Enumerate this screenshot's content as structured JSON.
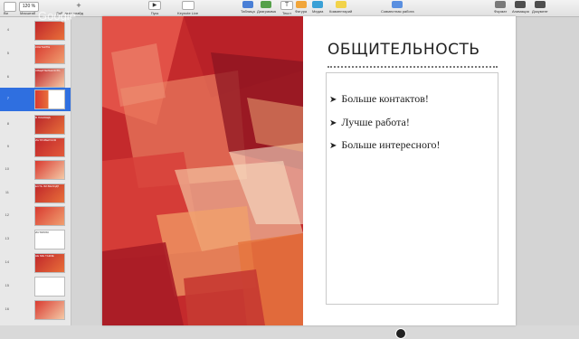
{
  "toolbar": {
    "zoom": "120 %",
    "view_label": "Ви",
    "left_labels": [
      "Масштаб",
      "Доб. авто.слайд"
    ],
    "buttons": [
      {
        "label": "Пуск",
        "icon": "play-icon"
      },
      {
        "label": "Keynote Live",
        "icon": "broadcast-icon"
      },
      {
        "label": "Таблица",
        "icon": "table-icon",
        "color": "#4a7fd6"
      },
      {
        "label": "Диаграмма",
        "icon": "chart-icon",
        "color": "#55a04a"
      },
      {
        "label": "Текст",
        "icon": "text-icon",
        "color": "#888888"
      },
      {
        "label": "Фигура",
        "icon": "shape-icon",
        "color": "#f1a53a"
      },
      {
        "label": "Медиа",
        "icon": "media-icon",
        "color": "#3aa0d6"
      },
      {
        "label": "Комментарий",
        "icon": "comment-icon",
        "color": "#f2d34a"
      },
      {
        "label": "Совместная работа",
        "icon": "collaborate-icon",
        "color": "#5a8fe0"
      },
      {
        "label": "Формат",
        "icon": "format-icon",
        "color": "#7a7a7a"
      },
      {
        "label": "Анимация",
        "icon": "animate-icon",
        "color": "#4e4e4e"
      },
      {
        "label": "Документ",
        "icon": "document-icon",
        "color": "#4e4e4e"
      }
    ]
  },
  "watermark": "Google",
  "sidebar": {
    "thumbnails": [
      {
        "num": "4",
        "caption": ""
      },
      {
        "num": "5",
        "caption": "КОНТАКТЫ"
      },
      {
        "num": "6",
        "caption": "ОБЩИТЕЛЬНОСТЬ"
      },
      {
        "num": "7",
        "caption": "",
        "selected": true
      },
      {
        "num": "8",
        "caption": "В ПОМОЩЬ"
      },
      {
        "num": "9",
        "caption": "ИНТРОВЕРСИЯ"
      },
      {
        "num": "10",
        "caption": ""
      },
      {
        "num": "11",
        "caption": "ЕСТЬ ЛИ ВЫХОД?"
      },
      {
        "num": "12",
        "caption": ""
      },
      {
        "num": "13",
        "caption": "ИСТОРИЯ"
      },
      {
        "num": "14",
        "caption": "НЕ МЫ ТАКИЕ"
      },
      {
        "num": "15",
        "caption": ""
      },
      {
        "num": "16",
        "caption": ""
      }
    ]
  },
  "slide": {
    "title": "ОБЩИТЕЛЬНОСТЬ",
    "bullets": [
      "Больше контактов!",
      "Лучше работа!",
      "Больше интересного!"
    ],
    "bullet_marker": "➤"
  },
  "colors": {
    "selection": "#2f6fe0",
    "art_red": "#c0262a",
    "art_orange": "#e8703a",
    "art_light": "#f4c9a6"
  }
}
